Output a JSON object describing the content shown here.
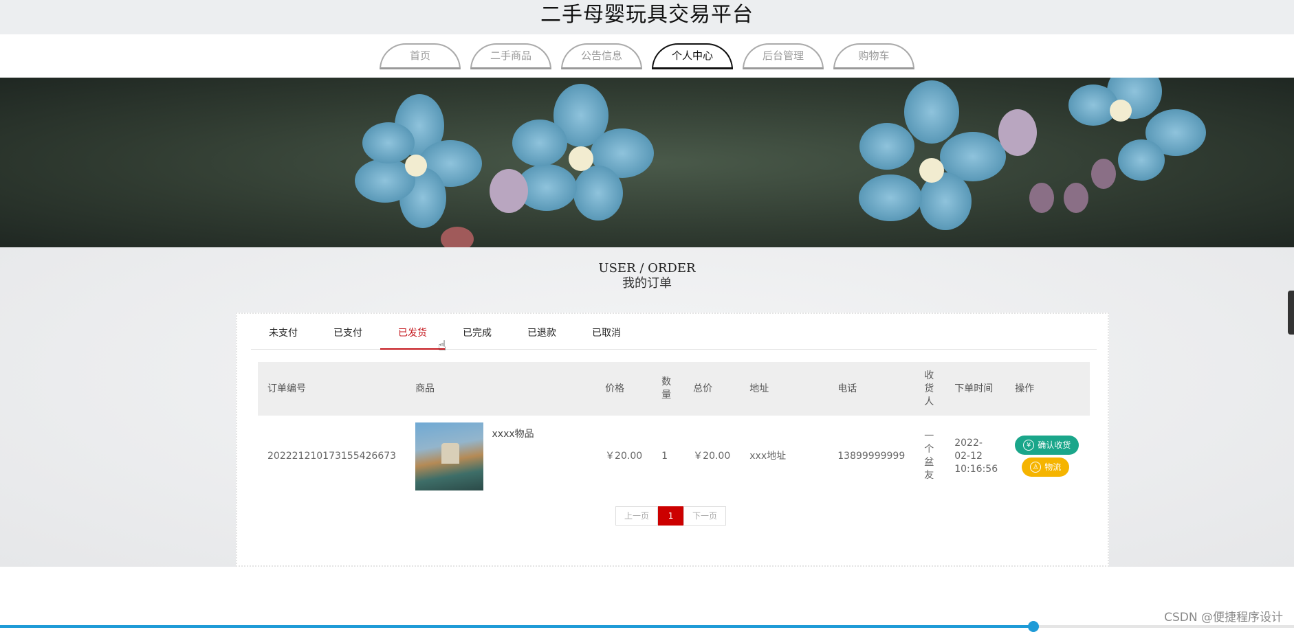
{
  "header": {
    "title": "二手母婴玩具交易平台"
  },
  "nav": {
    "items": [
      {
        "label": "首页"
      },
      {
        "label": "二手商品"
      },
      {
        "label": "公告信息"
      },
      {
        "label": "个人中心"
      },
      {
        "label": "后台管理"
      },
      {
        "label": "购物车"
      }
    ],
    "active": "个人中心"
  },
  "section": {
    "title_en": "USER / ORDER",
    "title_cn": "我的订单"
  },
  "tabs": {
    "items": [
      {
        "label": "未支付"
      },
      {
        "label": "已支付"
      },
      {
        "label": "已发货"
      },
      {
        "label": "已完成"
      },
      {
        "label": "已退款"
      },
      {
        "label": "已取消"
      }
    ],
    "active": "已发货"
  },
  "table": {
    "headers": {
      "order_no": "订单编号",
      "goods": "商品",
      "price": "价格",
      "qty": "数量",
      "total": "总价",
      "address": "地址",
      "phone": "电话",
      "receiver": "收货人",
      "time": "下单时间",
      "actions": "操作"
    },
    "rows": [
      {
        "order_no": "20222121017315542667 3",
        "goods_name": "xxxx物品",
        "price": "￥20.00",
        "qty": "1",
        "total": "￥20.00",
        "address": "xxx地址",
        "phone": "13899999999",
        "receiver": "一个盆友",
        "time": "2022-02-12 10:16:56",
        "btn_confirm": "确认收货",
        "btn_logistics": "物流"
      }
    ]
  },
  "pager": {
    "prev": "上一页",
    "current": "1",
    "next": "下一页"
  },
  "progress": {
    "fraction": 0.8
  },
  "watermark": "CSDN @便捷程序设计"
}
